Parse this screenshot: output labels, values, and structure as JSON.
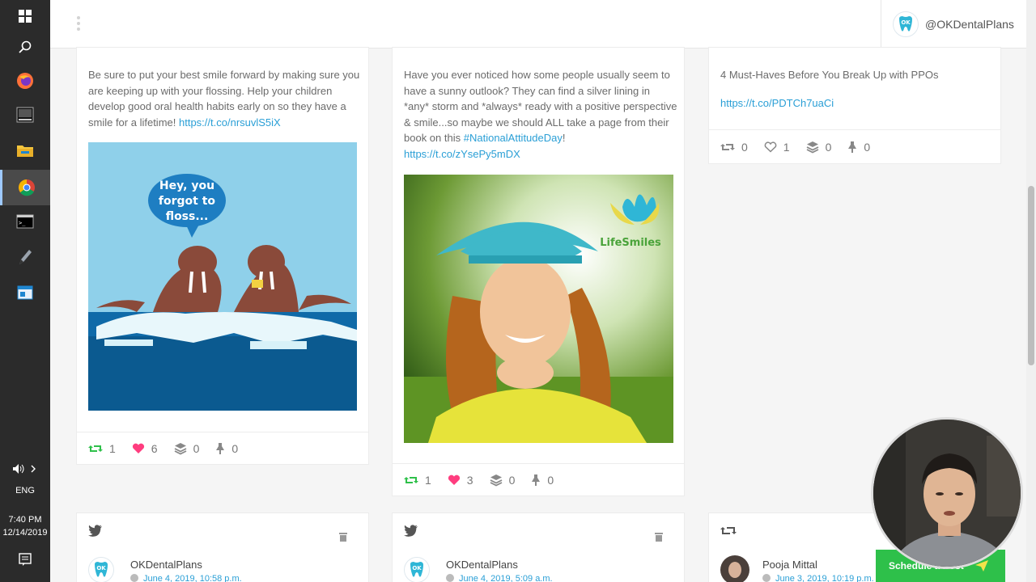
{
  "taskbar": {
    "lang": "ENG",
    "time": "7:40 PM",
    "date": "12/14/2019"
  },
  "header": {
    "account_handle": "@OKDentalPlans"
  },
  "colors": {
    "link": "#2a9fd6",
    "like": "#ff3d7f",
    "retweet": "#2ec04a",
    "schedule_button": "#2ec04a"
  },
  "posts": [
    {
      "text": "Be sure to put your best smile forward by making sure you are keeping up with your flossing. Help your children develop good oral health habits early on so they have a smile for a lifetime!",
      "link": "https://t.co/nrsuvlS5iX",
      "image_caption": "Hey, you forgot to floss...",
      "retweets": "1",
      "likes": "6",
      "stacks": "0",
      "pins": "0"
    },
    {
      "text": "Have you ever noticed how some people usually seem to have a sunny outlook? They can find a silver lining in *any* storm and *always* ready with a positive perspective & smile...so maybe we should ALL take a page from their book on this",
      "hashtag": "#NationalAttitudeDay",
      "hashtag_suffix": "!",
      "link": "https://t.co/zYsePy5mDX",
      "image_logo": "LifeSmiles",
      "retweets": "1",
      "likes": "3",
      "stacks": "0",
      "pins": "0"
    },
    {
      "text": "4 Must-Haves Before You Break Up with PPOs",
      "link": "https://t.co/PDTCh7uaCi",
      "retweets": "0",
      "likes": "1",
      "stacks": "0",
      "pins": "0"
    }
  ],
  "next_row": [
    {
      "type": "twitter-icon",
      "name": "OKDentalPlans",
      "date": "June 4, 2019, 10:58 p.m."
    },
    {
      "type": "twitter-icon",
      "name": "OKDentalPlans",
      "date": "June 4, 2019, 5:09 a.m."
    },
    {
      "type": "retweet-icon",
      "name": "Pooja Mittal",
      "date": "June 3, 2019, 10:19 p.m."
    }
  ],
  "schedule_button_label": "Schedule a Post"
}
